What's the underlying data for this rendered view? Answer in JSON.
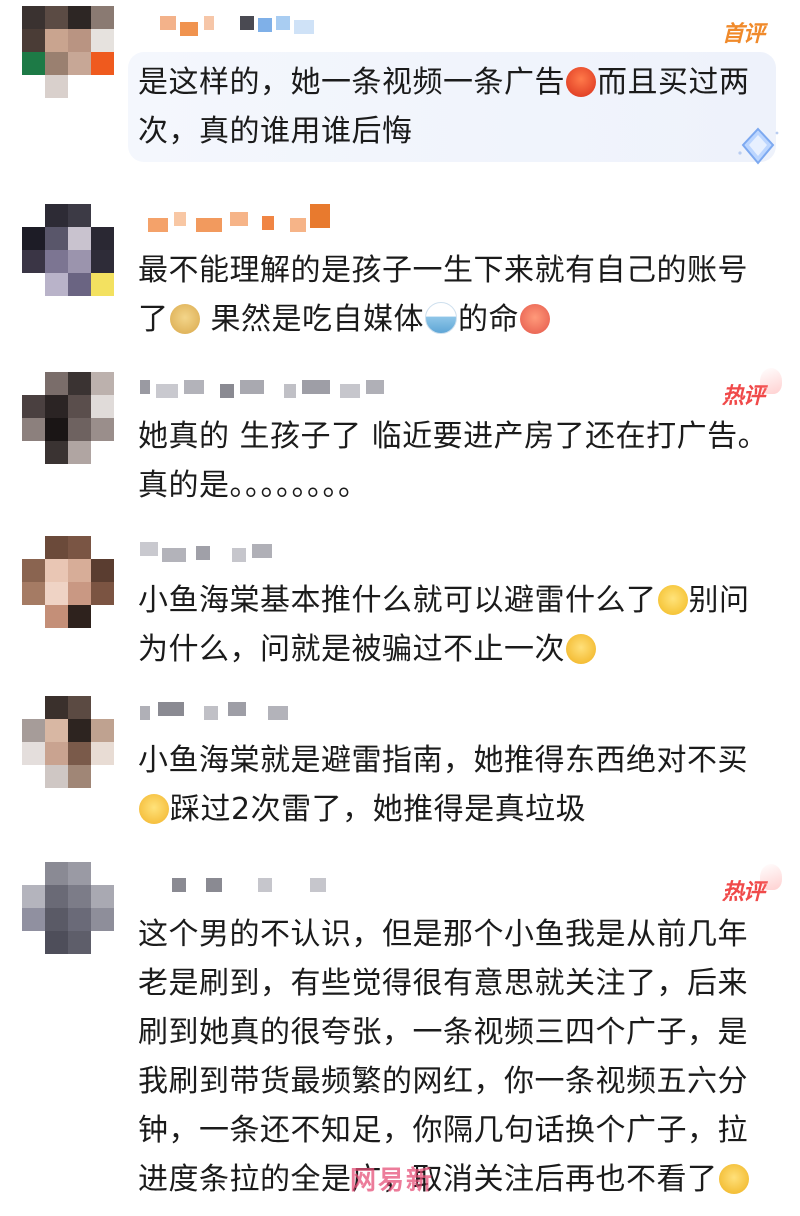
{
  "comments": [
    {
      "badge": "首评",
      "segments": [
        "是这样的，她一条视频一条广告",
        "而且买过两次，真的谁用谁后悔"
      ],
      "emoji_icons": [
        "angry-face-icon"
      ]
    },
    {
      "badge": "",
      "segments": [
        "最不能理解的是孩子一生下来就有自己的账号了",
        " 果然是吃自媒体",
        "的命",
        ""
      ],
      "emoji_icons": [
        "doge-icon",
        "rice-bowl-icon",
        "laughing-face-icon"
      ]
    },
    {
      "badge": "热评",
      "segments": [
        "她真的 生孩子了 临近要进产房了还在打广告。真的是。。。。。。。。"
      ],
      "emoji_icons": []
    },
    {
      "badge": "",
      "segments": [
        "小鱼海棠基本推什么就可以避雷什么了",
        "别问为什么，问就是被骗过不止一次",
        ""
      ],
      "emoji_icons": [
        "smile-face-icon",
        "hug-face-icon"
      ]
    },
    {
      "badge": "",
      "segments": [
        "小鱼海棠就是避雷指南，她推得东西绝对不买",
        "踩过2次雷了，她推得是真垃圾"
      ],
      "emoji_icons": [
        "blush-face-icon"
      ]
    },
    {
      "badge": "热评",
      "segments": [
        "这个男的不认识，但是那个小鱼我是从前几年老是刷到，有些觉得很有意思就关注了，后来刷到她真的很夸张，一条视频三四个广子，是我刷到带货最频繁的网红，你一条视频五六分钟，一条还不知足，你隔几句话换个广子，拉进度条拉的全是广，取消关注后再也不看了",
        ""
      ],
      "emoji_icons": [
        "smirk-face-icon"
      ]
    }
  ],
  "watermark": "网易新",
  "colors": {
    "badge_first": "#f08a2b",
    "badge_hot": "#f04a4a",
    "text": "#1b1b1b",
    "highlight_bg": "#eef2fb"
  }
}
